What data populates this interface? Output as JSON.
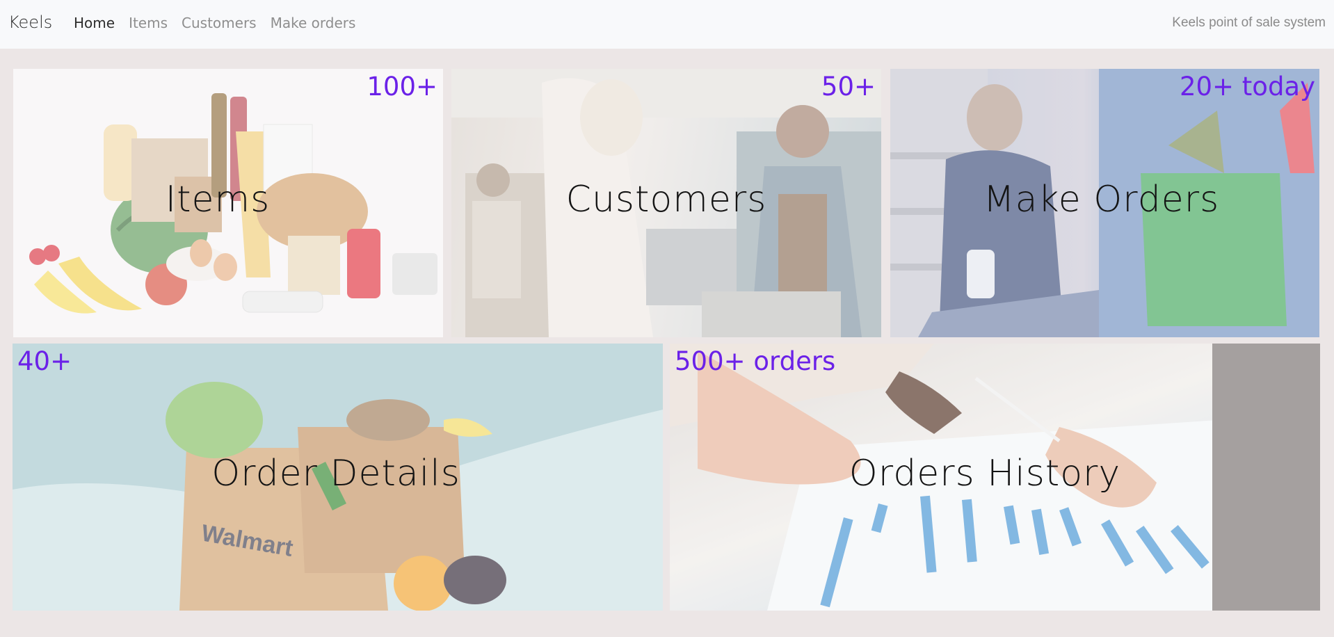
{
  "navbar": {
    "brand": "Keels",
    "links": [
      {
        "label": "Home",
        "active": true
      },
      {
        "label": "Items",
        "active": false
      },
      {
        "label": "Customers",
        "active": false
      },
      {
        "label": "Make orders",
        "active": false
      }
    ],
    "tagline": "Keels point of sale system"
  },
  "tiles": [
    {
      "title": "Items",
      "count": "100+"
    },
    {
      "title": "Customers",
      "count": "50+"
    },
    {
      "title": "Make Orders",
      "count": "20+ today"
    },
    {
      "title": "Order Details",
      "count": "40+"
    },
    {
      "title": "Orders History",
      "count": "500+ orders"
    }
  ],
  "bag_text": "Walmart",
  "theme": {
    "accent": "#6b21e8",
    "navbar_bg": "#f8f9fb",
    "page_bg": "#ece6e6"
  }
}
